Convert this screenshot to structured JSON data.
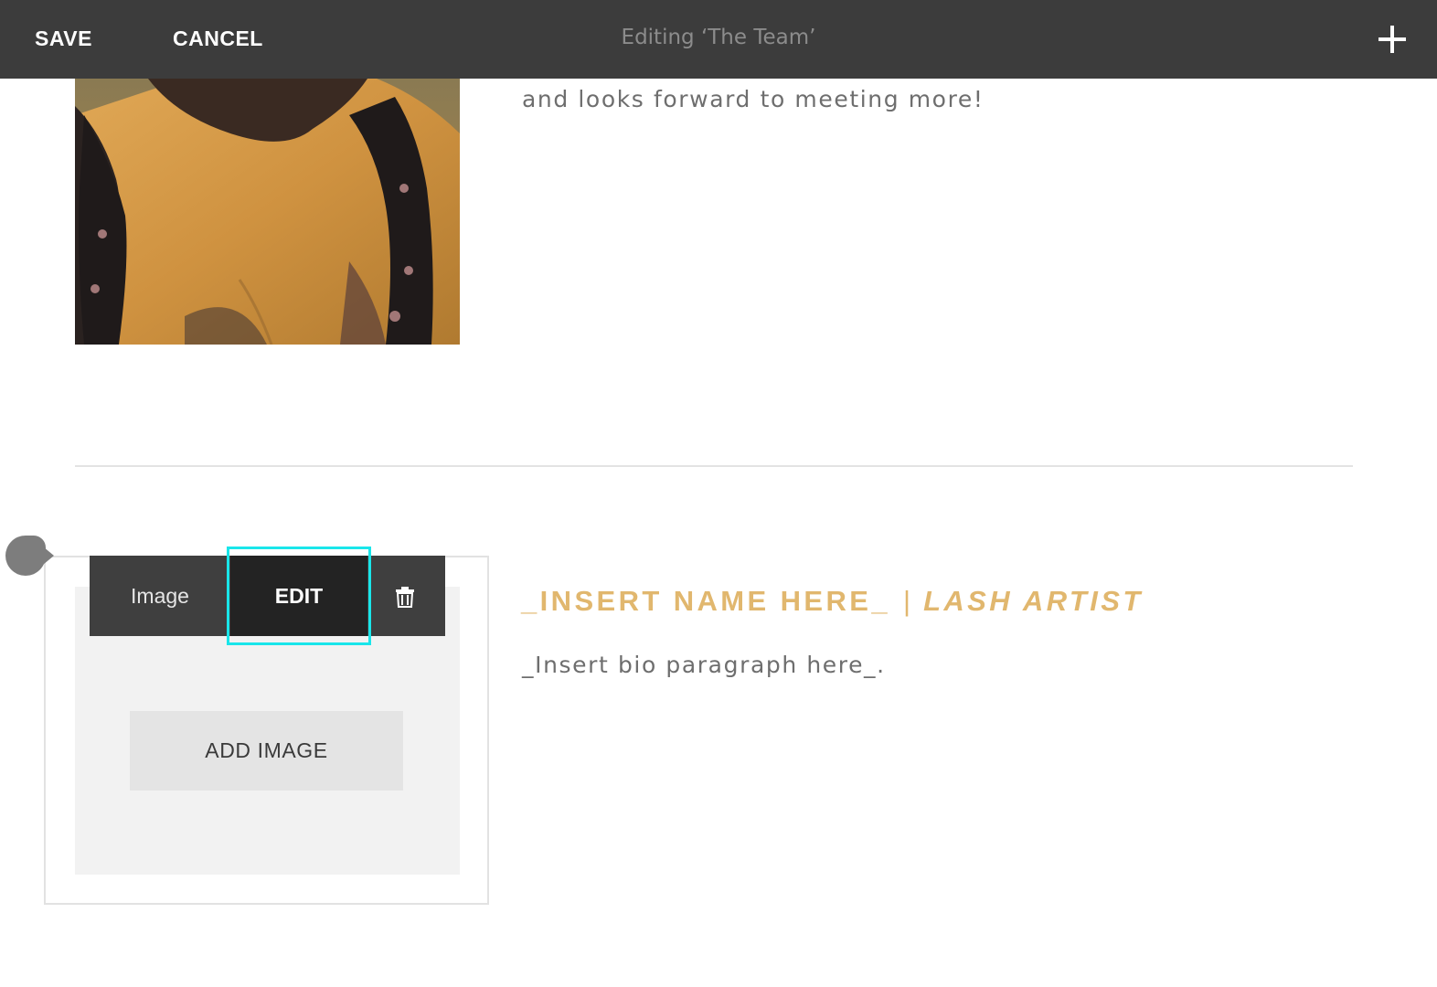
{
  "toolbar": {
    "save_label": "SAVE",
    "cancel_label": "CANCEL",
    "title": "Editing ‘The Team’",
    "add_icon": "plus-icon"
  },
  "upper_member": {
    "photo": "team-member-photo",
    "bio_text": "and looks forward to meeting more!"
  },
  "lower_member": {
    "block_toolbar": {
      "type_label": "Image",
      "edit_label": "EDIT",
      "delete_icon": "trash-icon"
    },
    "add_image_label": "ADD IMAGE",
    "name": "_INSERT NAME HERE_",
    "separator": "|",
    "role": "LASH ARTIST",
    "bio_text": "_Insert bio paragraph here_."
  },
  "colors": {
    "toolbar_bg": "#3c3c3c",
    "heading_gold": "#e1b76e",
    "focus_ring": "#19e6ea",
    "body_text": "#6e6e6e"
  }
}
